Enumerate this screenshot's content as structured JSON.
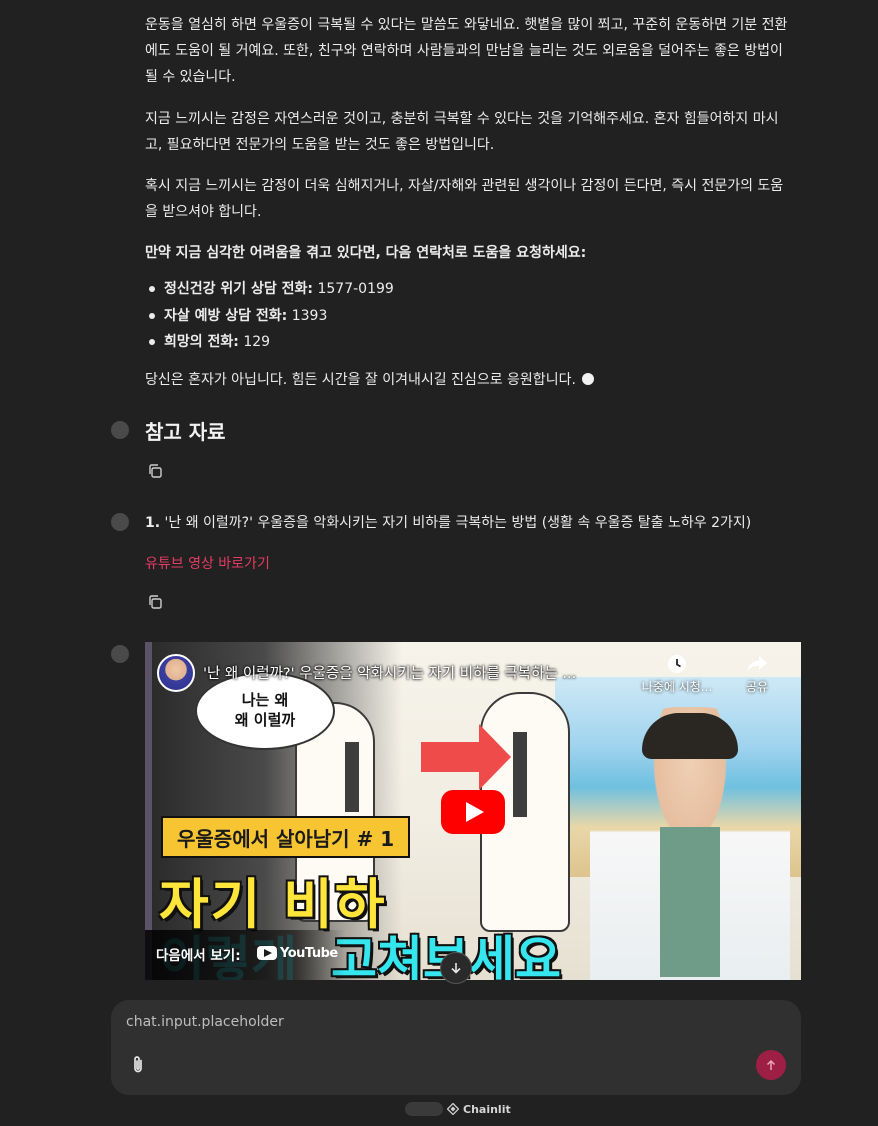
{
  "message": {
    "para1": "운동을 열심히 하면 우울증이 극복될 수 있다는 말씀도 와닿네요. 햇볕을 많이 쬐고, 꾸준히 운동하면 기분 전환에도 도움이 될 거예요. 또한, 친구와 연락하며 사람들과의 만남을 늘리는 것도 외로움을 덜어주는 좋은 방법이 될 수 있습니다.",
    "para2": "지금 느끼시는 감정은 자연스러운 것이고, 충분히 극복할 수 있다는 것을 기억해주세요. 혼자 힘들어하지 마시고, 필요하다면 전문가의 도움을 받는 것도 좋은 방법입니다.",
    "para3": "혹시 지금 느끼시는 감정이 더욱 심해지거나, 자살/자해와 관련된 생각이나 감정이 든다면, 즉시 전문가의 도움을 받으셔야 합니다.",
    "emergency_heading": "만약 지금 심각한 어려움을 겪고 있다면, 다음 연락처로 도움을 요청하세요:",
    "hotlines": [
      {
        "label": "정신건강 위기 상담 전화:",
        "number": "1577-0199"
      },
      {
        "label": "자살 예방 상담 전화:",
        "number": "1393"
      },
      {
        "label": "희망의 전화:",
        "number": "129"
      }
    ],
    "closing": "당신은 혼자가 아닙니다. 힘든 시간을 잘 이겨내시길 진심으로 응원합니다."
  },
  "references": {
    "title": "참고 자료",
    "item1": {
      "number": "1.",
      "text": "'난 왜 이럴까?' 우울증을 악화시키는 자기 비하를 극복하는 방법 (생활 속 우울증 탈출 노하우 2가지)",
      "link_label": "유튜브 영상 바로가기"
    }
  },
  "video": {
    "title": "'난 왜 이럴까?' 우울증을 악화시키는 자기 비하를 극복하는 ...",
    "watch_later_label": "나중에 시청...",
    "share_label": "공유",
    "bubble_line1": "나는 왜",
    "bubble_line2": "왜 이럴까",
    "banner_text": "우울증에서 살아남기 # 1",
    "headline1": "자기 비하",
    "headline2_left": "이렇게",
    "headline2": "고쳐보세요",
    "watch_on_label": "다음에서 보기:",
    "youtube_text": "YouTube"
  },
  "composer": {
    "placeholder": "chat.input.placeholder"
  },
  "footer": {
    "brand": "Chainlit"
  },
  "colors": {
    "background": "#212121",
    "link": "#e43c62",
    "send_button": "#9e1f46",
    "composer": "#303030"
  }
}
